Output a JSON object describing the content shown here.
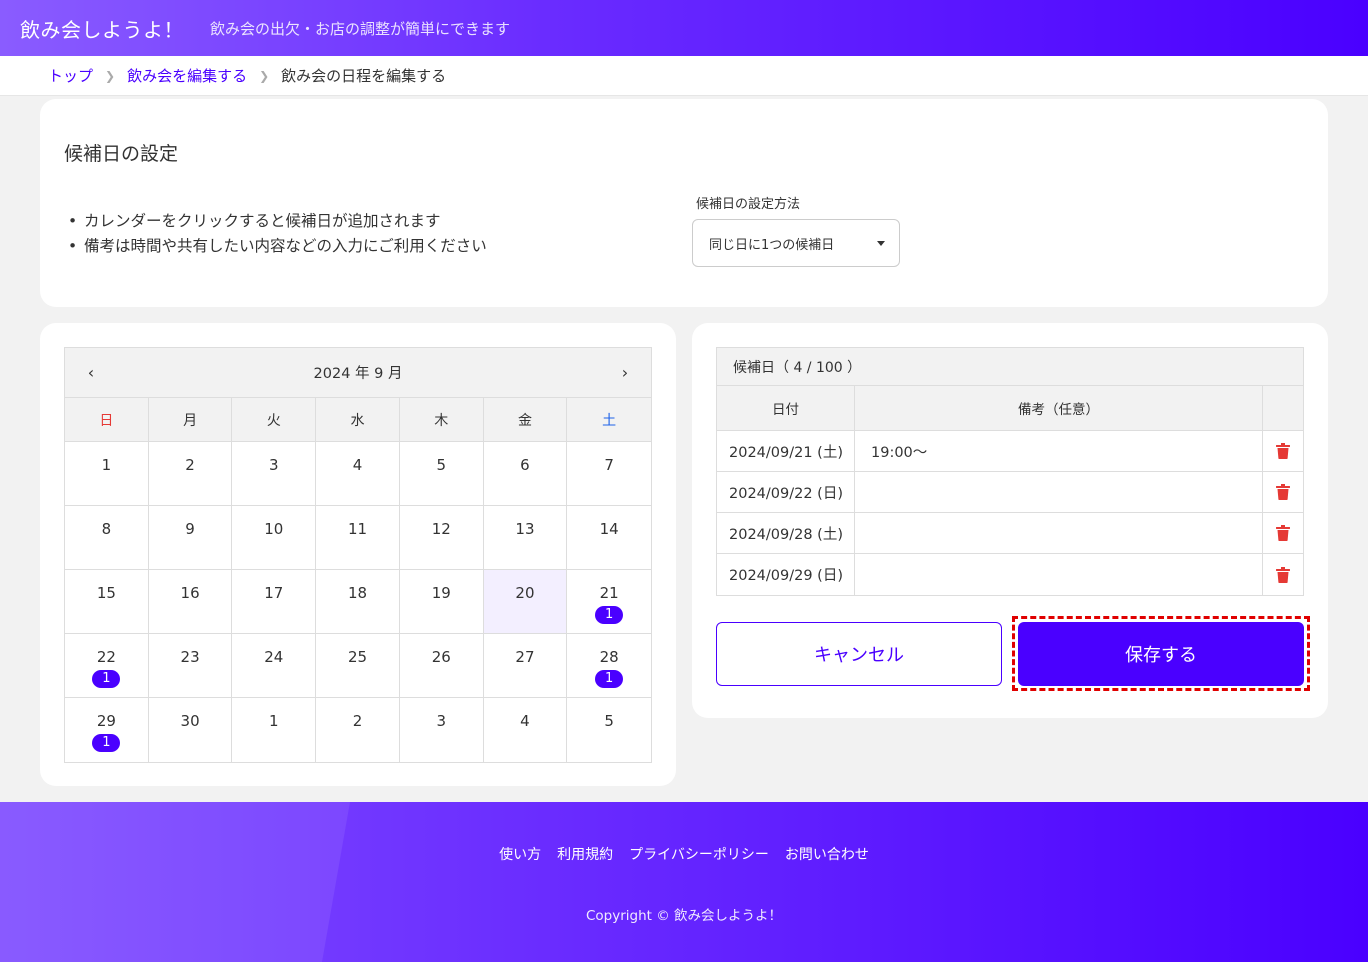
{
  "header": {
    "brand": "飲み会しようよ！",
    "tagline": "飲み会の出欠・お店の調整が簡単にできます"
  },
  "breadcrumb": {
    "top": "トップ",
    "edit_event": "飲み会を編集する",
    "current": "飲み会の日程を編集する"
  },
  "settings": {
    "title": "候補日の設定",
    "notes": [
      "カレンダーをクリックすると候補日が追加されます",
      "備考は時間や共有したい内容などの入力にご利用ください"
    ],
    "method_label": "候補日の設定方法",
    "method_value": "同じ日に1つの候補日"
  },
  "calendar": {
    "month_label": "2024 年 9 月",
    "prev_icon": "chevron-left-icon",
    "next_icon": "chevron-right-icon",
    "weekdays": [
      "日",
      "月",
      "火",
      "水",
      "木",
      "金",
      "土"
    ],
    "weeks": [
      [
        {
          "d": "1",
          "c": ""
        },
        {
          "d": "2",
          "c": ""
        },
        {
          "d": "3",
          "c": ""
        },
        {
          "d": "4",
          "c": ""
        },
        {
          "d": "5",
          "c": ""
        },
        {
          "d": "6",
          "c": ""
        },
        {
          "d": "7",
          "c": ""
        }
      ],
      [
        {
          "d": "8",
          "c": ""
        },
        {
          "d": "9",
          "c": ""
        },
        {
          "d": "10",
          "c": ""
        },
        {
          "d": "11",
          "c": ""
        },
        {
          "d": "12",
          "c": ""
        },
        {
          "d": "13",
          "c": ""
        },
        {
          "d": "14",
          "c": ""
        }
      ],
      [
        {
          "d": "15",
          "c": ""
        },
        {
          "d": "16",
          "c": ""
        },
        {
          "d": "17",
          "c": ""
        },
        {
          "d": "18",
          "c": ""
        },
        {
          "d": "19",
          "c": ""
        },
        {
          "d": "20",
          "c": "",
          "today": true
        },
        {
          "d": "21",
          "c": "1"
        }
      ],
      [
        {
          "d": "22",
          "c": "1"
        },
        {
          "d": "23",
          "c": ""
        },
        {
          "d": "24",
          "c": ""
        },
        {
          "d": "25",
          "c": ""
        },
        {
          "d": "26",
          "c": ""
        },
        {
          "d": "27",
          "c": ""
        },
        {
          "d": "28",
          "c": "1"
        }
      ],
      [
        {
          "d": "29",
          "c": "1"
        },
        {
          "d": "30",
          "c": ""
        },
        {
          "d": "1",
          "c": ""
        },
        {
          "d": "2",
          "c": ""
        },
        {
          "d": "3",
          "c": ""
        },
        {
          "d": "4",
          "c": ""
        },
        {
          "d": "5",
          "c": ""
        }
      ]
    ]
  },
  "candidates": {
    "caption": "候補日（ 4 / 100 ）",
    "col_date": "日付",
    "col_note": "備考（任意）",
    "rows": [
      {
        "date": "2024/09/21 (土)",
        "note": "19:00～"
      },
      {
        "date": "2024/09/22 (日)",
        "note": ""
      },
      {
        "date": "2024/09/28 (土)",
        "note": ""
      },
      {
        "date": "2024/09/29 (日)",
        "note": ""
      }
    ],
    "delete_icon": "trash-icon"
  },
  "actions": {
    "cancel": "キャンセル",
    "save": "保存する"
  },
  "footer": {
    "links": [
      "使い方",
      "利用規約",
      "プライバシーポリシー",
      "お問い合わせ"
    ],
    "copyright": "Copyright © 飲み会しようよ！"
  },
  "colors": {
    "accent": "#4a00ff",
    "sunday": "#e53935",
    "saturday": "#1e62e8",
    "delete": "#e53935",
    "highlight": "#e00000"
  }
}
